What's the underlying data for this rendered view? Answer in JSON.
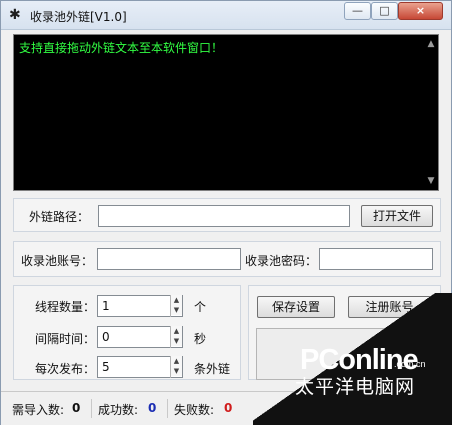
{
  "window": {
    "title": "收录池外链[V1.0]",
    "icon_name": "spider-icon",
    "controls": {
      "minimize_label": "—",
      "maximize_label": "□",
      "close_label": "×"
    }
  },
  "console": {
    "message": "支持直接拖动外链文本至本软件窗口！",
    "scroll_up_label": "▲",
    "scroll_down_label": "▼"
  },
  "link_path": {
    "label": "外链路径：",
    "value": "",
    "open_button": "打开文件"
  },
  "account": {
    "account_label": "收录池账号：",
    "account_value": "",
    "password_label": "收录池密码：",
    "password_value": ""
  },
  "settings": {
    "threads_label": "线程数量：",
    "threads_value": "1",
    "threads_unit": "个",
    "interval_label": "间隔时间：",
    "interval_value": "0",
    "interval_unit": "秒",
    "publish_label": "每次发布：",
    "publish_value": "5",
    "publish_unit": "条外链",
    "spin_up": "▲",
    "spin_down": "▼"
  },
  "actions": {
    "save_settings": "保存设置",
    "register_account": "注册账号"
  },
  "status": {
    "to_import_label": "需导入数:",
    "to_import_value": "0",
    "success_label": "成功数:",
    "success_value": "0",
    "failed_label": "失败数:",
    "failed_value": "0",
    "success_color": "#1b2db3",
    "failed_color": "#d01c1c"
  },
  "watermark": {
    "brand": "PConline",
    "domain": ".com.cn",
    "chinese_name": "太平洋电脑网"
  },
  "colors": {
    "console_background": "#000000",
    "console_text": "#32ff43",
    "window_background": "#f0f0f0"
  }
}
